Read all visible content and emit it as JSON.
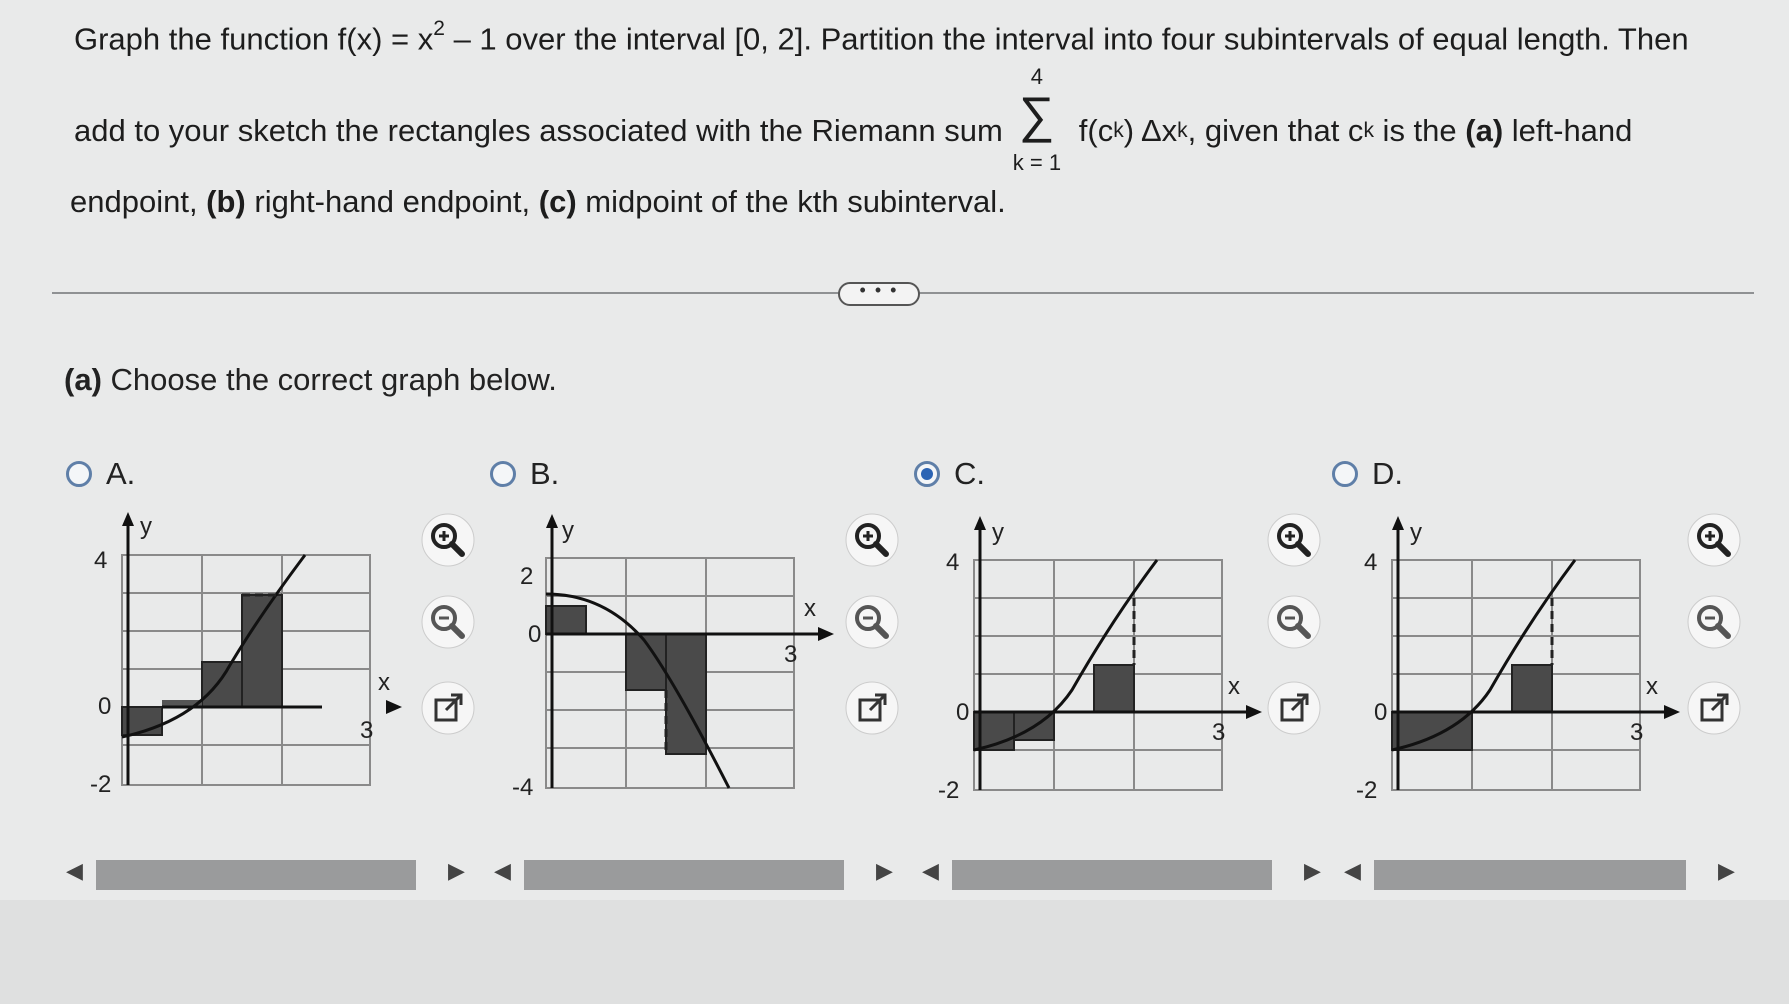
{
  "question": {
    "line1_a": "Graph the function f(x) = x",
    "line1_exp": "2",
    "line1_b": " – 1 over the interval [0, 2]. Partition the interval into four subintervals of equal length. Then",
    "line2_a": "add to your sketch the rectangles associated with the Riemann sum",
    "sigma_upper": "4",
    "sigma_symbol": "∑",
    "sigma_lower": "k = 1",
    "line2_expr": "f(c",
    "line2_expr_sub": "k",
    "line2_expr_b": ") Δx",
    "line2_expr_sub2": "k",
    "line2_b": ", given that c",
    "line2_b_sub": "k",
    "line2_c": " is the ",
    "line2_a_bold": "(a)",
    "line2_d": " left-hand",
    "line3_b_bold": "(b)",
    "line3_a": "endpoint, ",
    "line3_b": " right-hand endpoint, ",
    "line3_c_bold": "(c)",
    "line3_c": " midpoint of the kth subinterval."
  },
  "more_pill": "• • •",
  "part": {
    "bold": "(a)",
    "text": " Choose the correct graph below."
  },
  "options": [
    {
      "letter": "A.",
      "selected": false,
      "ytop": "4",
      "yzero": "0",
      "ybot": "-2",
      "xlabel": "x",
      "xtick": "3",
      "ylabel": "y"
    },
    {
      "letter": "B.",
      "selected": false,
      "ytop": "2",
      "yzero": "0",
      "ybot": "-4",
      "xlabel": "x",
      "xtick": "3",
      "ylabel": "y"
    },
    {
      "letter": "C.",
      "selected": true,
      "ytop": "4",
      "yzero": "0",
      "ybot": "-2",
      "xlabel": "x",
      "xtick": "3",
      "ylabel": "y"
    },
    {
      "letter": "D.",
      "selected": false,
      "ytop": "4",
      "yzero": "0",
      "ybot": "-2",
      "xlabel": "x",
      "xtick": "3",
      "ylabel": "y"
    }
  ],
  "icons": {
    "zoom_in": "zoom-in-icon",
    "zoom_out": "zoom-out-icon",
    "open_new": "open-new-window-icon"
  },
  "colors": {
    "accent": "#2c64b4",
    "radio_border": "#5f7fa8",
    "rect_fill": "#4a4a4a",
    "grid": "#8a8a8a"
  }
}
